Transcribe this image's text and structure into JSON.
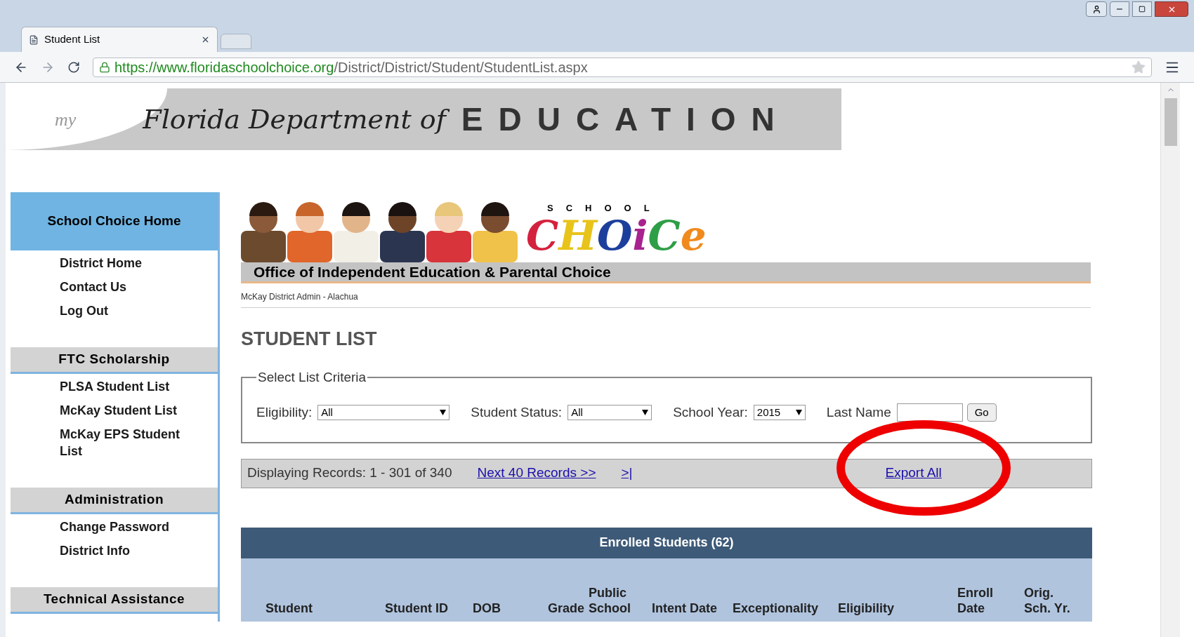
{
  "browser": {
    "tab_title": "Student List",
    "url_host": "https://www.floridaschoolchoice.org",
    "url_path": "/District/District/Student/StudentList.aspx"
  },
  "header": {
    "logo_text": "my",
    "script_title": "Florida Department of",
    "title": "EDUCATION"
  },
  "sidebar": [
    {
      "heading": "School Choice Home",
      "selected": true,
      "items": [
        "District Home",
        "Contact Us",
        "Log Out"
      ]
    },
    {
      "heading": "FTC Scholarship",
      "selected": false,
      "items": [
        "PLSA Student List",
        "McKay Student List",
        "McKay EPS Student List"
      ]
    },
    {
      "heading": "Administration",
      "selected": false,
      "items": [
        "Change Password",
        "District Info"
      ]
    },
    {
      "heading": "Technical Assistance",
      "selected": false
    }
  ],
  "banner": {
    "logo_top": "SCHOOL",
    "logo_word": "CHOiCe",
    "office": "Office of Independent Education & Parental Choice",
    "user": "McKay District Admin - Alachua"
  },
  "page_title": "STUDENT LIST",
  "criteria": {
    "legend": "Select List Criteria",
    "eligibility": {
      "label": "Eligibility:",
      "value": "All"
    },
    "status": {
      "label": "Student Status:",
      "value": "All"
    },
    "year": {
      "label": "School Year:",
      "value": "2015"
    },
    "last_name": {
      "label": "Last Name"
    },
    "go": "Go"
  },
  "records": {
    "text": "Displaying Records: 1 - 301 of 340",
    "next": "Next 40 Records >>",
    "last": ">|",
    "export": "Export All"
  },
  "table": {
    "title": "Enrolled Students (62)",
    "columns": [
      "Student",
      "Student ID",
      "DOB",
      "Grade",
      "Public School",
      "Intent Date",
      "Exceptionality",
      "Eligibility",
      "Enroll Date",
      "Orig. Sch. Yr."
    ]
  }
}
